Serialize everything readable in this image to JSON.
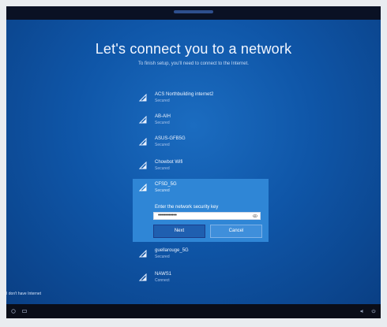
{
  "title": "Let's connect you to a network",
  "subtitle": "To finish setup, you'll need to connect to the Internet.",
  "networks_top": [
    {
      "name": "ACS Northbuilding internet2",
      "status": "Secured"
    },
    {
      "name": "AB-AIH",
      "status": "Secured"
    },
    {
      "name": "ASUS-GFB5G",
      "status": "Secured"
    },
    {
      "name": "Chowbot Wifi",
      "status": "Secured"
    }
  ],
  "selected_network": {
    "name": "CFSD_5G",
    "status": "Secured",
    "prompt": "Enter the network security key",
    "key_value": "••••••••••••",
    "next_label": "Next",
    "cancel_label": "Cancel"
  },
  "networks_bottom": [
    {
      "name": "guellarouge_5G",
      "status": "Secured"
    },
    {
      "name": "NAWS1",
      "status": "Connect"
    }
  ],
  "footer": {
    "no_internet_link": "I don't have Internet"
  },
  "icons": {
    "network": "wifi-icon",
    "reveal": "eye-icon",
    "accessibility": "accessibility-icon",
    "volume": "volume-icon",
    "power": "power-icon"
  },
  "colors": {
    "background": "#0f56a8",
    "selected_panel": "#2f86d6",
    "next_button": "#1f5fb0",
    "cancel_button": "#3f8fdb"
  }
}
